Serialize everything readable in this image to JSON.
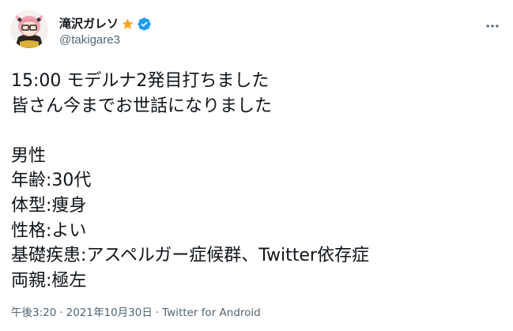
{
  "author": {
    "display_name": "滝沢ガレソ",
    "handle": "@takigare3",
    "star_icon": "star-icon",
    "verified_icon": "verified-badge-icon",
    "verified_color": "#1d9bf0",
    "star_color": "#f4a71d"
  },
  "tweet": {
    "lines": [
      "15:00 モデルナ2発目打ちました",
      "皆さん今までお世話になりました",
      "",
      "男性",
      "年齢:30代",
      "体型:痩身",
      "性格:よい",
      "基礎疾患:アスペルガー症候群、Twitter依存症",
      "両親:極左"
    ]
  },
  "meta": {
    "time": "午後3:20",
    "separator": "·",
    "date": "2021年10月30日",
    "source": "Twitter for Android"
  },
  "colors": {
    "text": "#0f1419",
    "secondary": "#536471"
  }
}
